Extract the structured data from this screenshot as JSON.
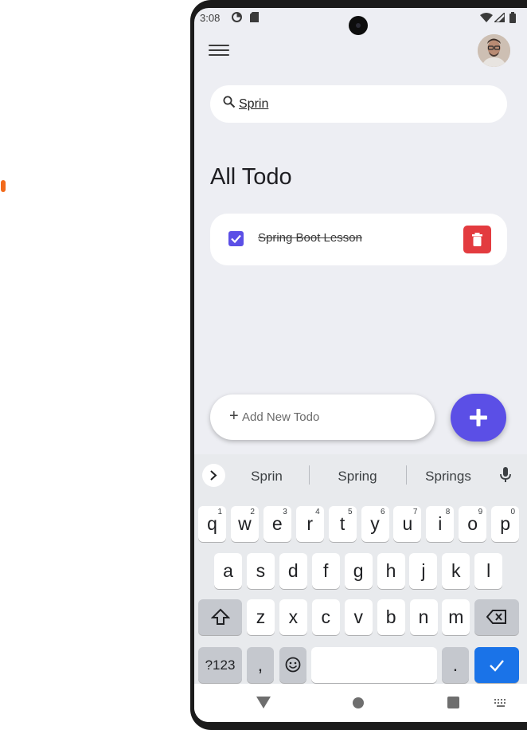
{
  "status_bar": {
    "time": "3:08"
  },
  "app": {
    "search": {
      "value": "Sprin",
      "placeholder": ""
    },
    "heading": "All Todo",
    "todos": [
      {
        "title": "Spring Boot Lesson",
        "done": true
      }
    ],
    "add_placeholder": "Add New Todo",
    "icons": [
      "menu-icon",
      "search-icon",
      "checkbox-checked-icon",
      "trash-icon",
      "plus-icon"
    ]
  },
  "keyboard": {
    "suggestions": [
      "Sprin",
      "Spring",
      "Springs"
    ],
    "row1": [
      {
        "k": "q",
        "h": "1"
      },
      {
        "k": "w",
        "h": "2"
      },
      {
        "k": "e",
        "h": "3"
      },
      {
        "k": "r",
        "h": "4"
      },
      {
        "k": "t",
        "h": "5"
      },
      {
        "k": "y",
        "h": "6"
      },
      {
        "k": "u",
        "h": "7"
      },
      {
        "k": "i",
        "h": "8"
      },
      {
        "k": "o",
        "h": "9"
      },
      {
        "k": "p",
        "h": "0"
      }
    ],
    "row2": [
      "a",
      "s",
      "d",
      "f",
      "g",
      "h",
      "j",
      "k",
      "l"
    ],
    "row3": [
      "z",
      "x",
      "c",
      "v",
      "b",
      "n",
      "m"
    ],
    "symbols_label": "?123",
    "comma": ",",
    "period": "."
  },
  "colors": {
    "accent": "#5b4fe6",
    "delete": "#e33b3f",
    "enter": "#1a73e8",
    "background": "#edeef3"
  }
}
